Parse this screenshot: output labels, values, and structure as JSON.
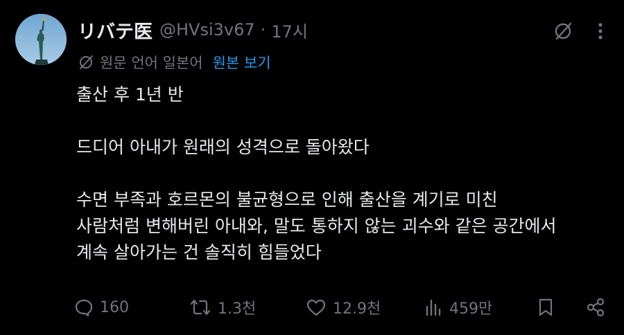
{
  "author": {
    "display_name": "リバテ医",
    "handle": "@HVsi3v67",
    "separator": "·",
    "time": "17시"
  },
  "translation": {
    "note": "원문 언어 일본어",
    "show_original": "원본 보기"
  },
  "post": {
    "lines": [
      "출산 후 1년 반",
      "",
      "드디어 아내가 원래의 성격으로 돌아왔다",
      "",
      "수면 부족과 호르몬의 불균형으로 인해 출산을 계기로 미친",
      "사람처럼 변해버린 아내와, 말도 통하지 않는 괴수와 같은 공간에서",
      "계속 살아가는 건 솔직히 힘들었다"
    ]
  },
  "actions": {
    "replies": "160",
    "reposts": "1.3천",
    "likes": "12.9천",
    "views": "459만"
  },
  "colors": {
    "background": "#000000",
    "text": "#e7e9ea",
    "muted": "#71767b",
    "accent": "#1d9bf0"
  }
}
